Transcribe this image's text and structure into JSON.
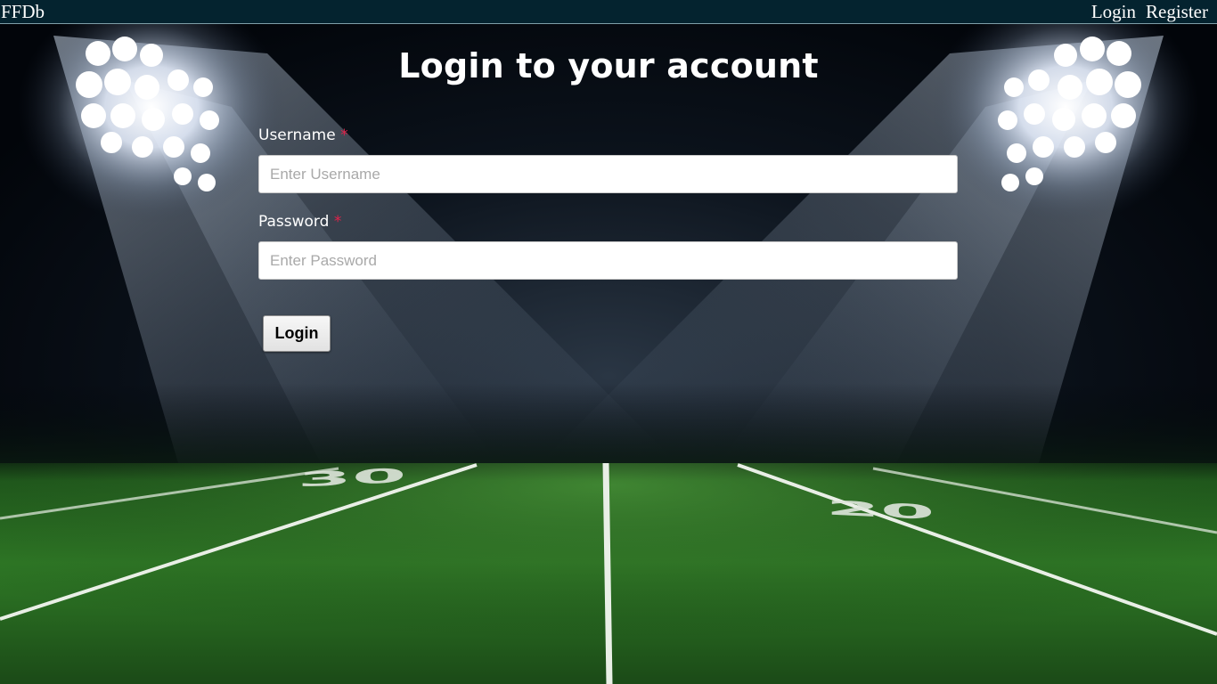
{
  "nav": {
    "brand": "FFDb",
    "links": [
      "Login",
      "Register"
    ]
  },
  "form": {
    "title": "Login to your account",
    "username": {
      "label": "Username",
      "required_mark": "*",
      "placeholder": "Enter Username",
      "value": ""
    },
    "password": {
      "label": "Password",
      "required_mark": "*",
      "placeholder": "Enter Password",
      "value": ""
    },
    "submit_label": "Login"
  },
  "background": {
    "yard_markers": [
      "30",
      "20"
    ]
  },
  "colors": {
    "nav_background": "#04232f",
    "required_mark": "#e0224a",
    "field_turf": "#2f7a26",
    "night_sky": "#02060b"
  }
}
